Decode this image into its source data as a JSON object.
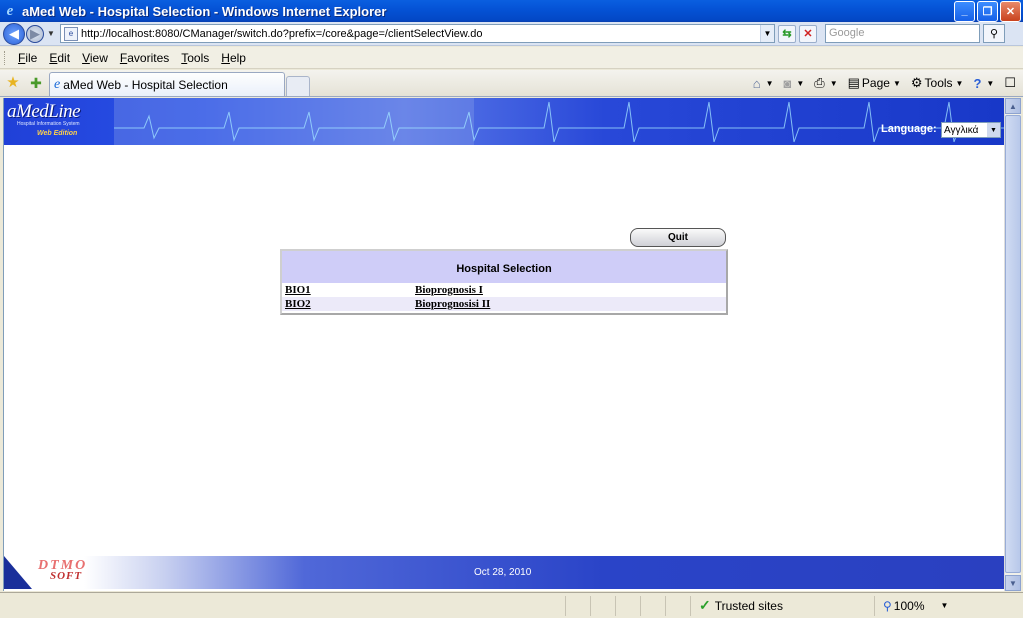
{
  "window": {
    "title": "aMed Web - Hospital Selection - Windows Internet Explorer",
    "minimize": "_",
    "restore": "❐",
    "close": "✕"
  },
  "address": {
    "url": "http://localhost:8080/CManager/switch.do?prefix=/core&page=/clientSelectView.do",
    "search_placeholder": "Google"
  },
  "menu": {
    "items": [
      {
        "ul": "F",
        "rest": "ile"
      },
      {
        "ul": "E",
        "rest": "dit"
      },
      {
        "ul": "V",
        "rest": "iew"
      },
      {
        "ul": "F",
        "rest": "avorites",
        "pre": ""
      },
      {
        "ul": "T",
        "rest": "ools"
      },
      {
        "ul": "H",
        "rest": "elp"
      }
    ]
  },
  "tabs": {
    "active_label": "aMed Web - Hospital Selection"
  },
  "commands": {
    "page": "Page",
    "tools": "Tools"
  },
  "header": {
    "logo": "aMedLine",
    "logo_sub": "Hospital Information System",
    "logo_edition": "Web Edition",
    "language_label": "Language:",
    "language_value": "Αγγλικά"
  },
  "main": {
    "quit_label": "Quit",
    "table_title": "Hospital Selection",
    "hospitals": [
      {
        "code": "BIO1",
        "name": "Bioprognosis I"
      },
      {
        "code": "BIO2",
        "name": "Bioprognosisi II"
      }
    ]
  },
  "footer": {
    "logo_line1": "DTMO",
    "logo_line2": "SOFT",
    "date": "Oct 28, 2010"
  },
  "status": {
    "zone": "Trusted sites",
    "zoom": "100%"
  },
  "colors": {
    "title_bar": "#0553d6",
    "banner_blue": "#2a52e8",
    "table_header": "#cfcdf8",
    "alt_row": "#eceaf9"
  }
}
